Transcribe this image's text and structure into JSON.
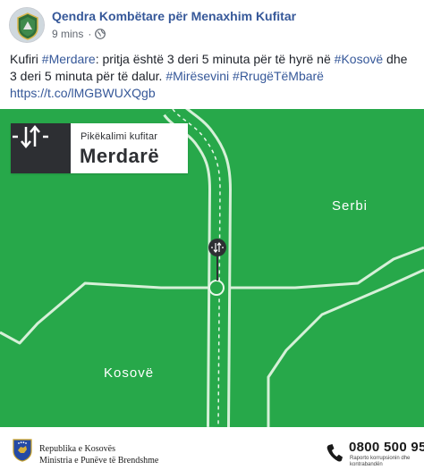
{
  "post": {
    "page_name": "Qendra Kombëtare për Menaxhim Kufitar",
    "timestamp": "9 mins",
    "separator": "·",
    "privacy_icon": "globe-icon",
    "text": {
      "l1_a": "Kufiri ",
      "l1_tag_merdare": "#Merdare",
      "l1_b": ": pritja është 3 deri 5 minuta për të hyrë në ",
      "l1_tag_kosove": "#Kosovë",
      "l1_c": " dhe",
      "l2_a": "3 deri 5 minuta për të dalur. ",
      "l2_tag_miresevini": "#Mirësevini",
      "l2_space": " ",
      "l2_tag_rruge": "#RrugëTëMbarë",
      "l3_link": "https://t.co/lMGBWUXQgb"
    }
  },
  "image": {
    "crossing": {
      "kind": "Pikëkalimi kufitar",
      "name": "Merdarë",
      "icon": "border-crossing-icon"
    },
    "countries": {
      "serbia": "Serbi",
      "kosovo": "Kosovë"
    },
    "footer": {
      "ministry_line1": "Republika e Kosovës",
      "ministry_line2": "Ministria e Punëve të Brendshme",
      "hotline": "0800 500 95",
      "hotline_caption_1": "Raporto korrupsionin dhe",
      "hotline_caption_2": "kontrabandën"
    },
    "colors": {
      "map_green": "#27a84a",
      "road_light": "#cdeccf",
      "card_dark": "#2d2f33",
      "link_blue": "#365899"
    }
  }
}
